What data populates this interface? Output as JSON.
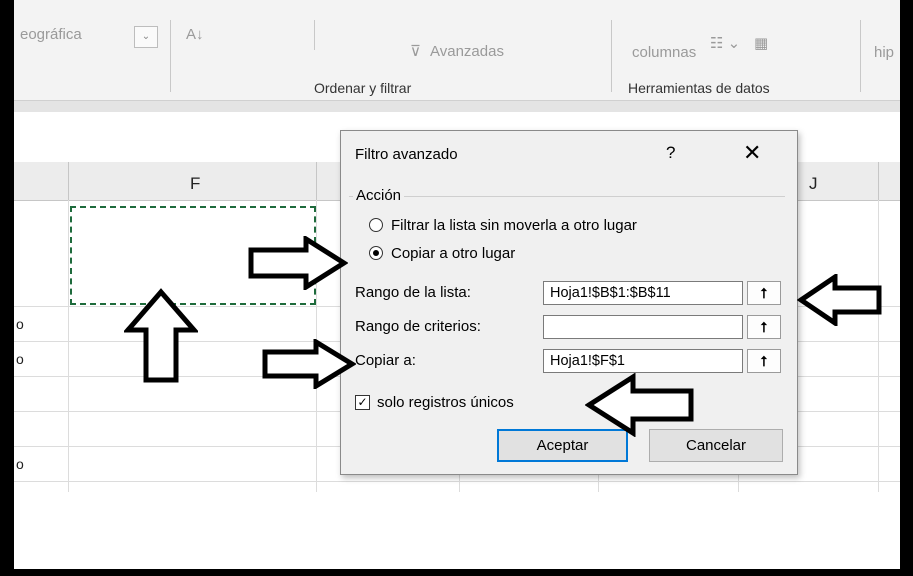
{
  "ribbon": {
    "fragment_left": "eográfica",
    "sort_icon_text": "A↓",
    "advanced_label": "Avanzadas",
    "columns_label": "columnas",
    "hip_fragment": "hip",
    "group_sort_filter": "Ordenar y filtrar",
    "group_data_tools": "Herramientas de datos"
  },
  "sheet": {
    "column_f": "F",
    "column_j": "J",
    "row_fragments": [
      "o",
      "o",
      "o"
    ]
  },
  "dialog": {
    "title": "Filtro avanzado",
    "help": "?",
    "close": "✕",
    "section_label": "Acción",
    "option_filter": "Filtrar la lista sin moverla a otro lugar",
    "option_copy": "Copiar a otro lugar",
    "selected_option": "copy",
    "list_range_label": "Rango de la lista:",
    "list_range_value": "Hoja1!$B$1:$B$11",
    "criteria_range_label": "Rango de criterios:",
    "criteria_range_value": "",
    "copy_to_label": "Copiar a:",
    "copy_to_value": "Hoja1!$F$1",
    "unique_label": "solo registros únicos",
    "unique_checked": true,
    "check_mark": "✓",
    "collapse_glyph": "⭡",
    "accept_label": "Aceptar",
    "cancel_label": "Cancelar"
  },
  "colors": {
    "marching_ants": "#1e6b3c",
    "default_button_border": "#0078d7",
    "annotation_arrows": "#000000"
  }
}
